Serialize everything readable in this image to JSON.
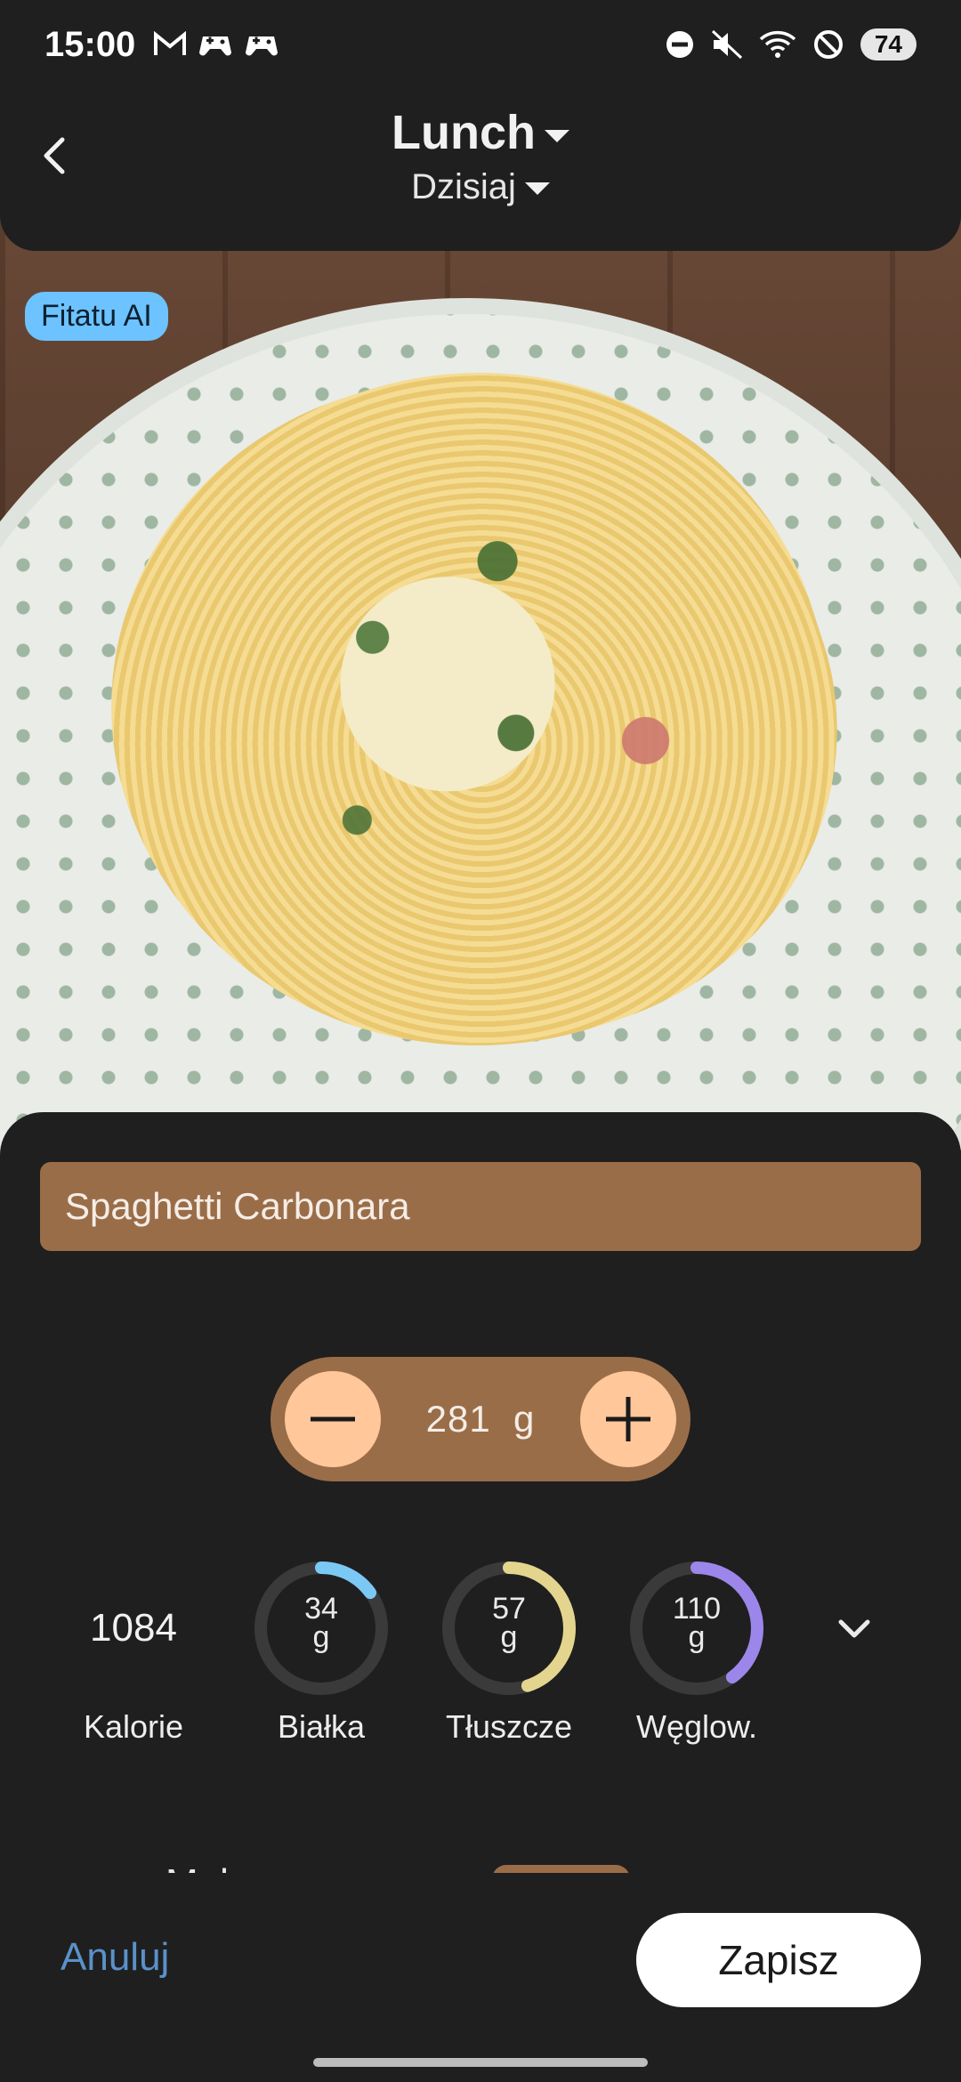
{
  "status_bar": {
    "time": "15:00",
    "battery": "74",
    "icons_left": [
      "gmail-icon",
      "game-icon",
      "game-icon"
    ],
    "icons_right": [
      "dnd-icon",
      "mute-icon",
      "wifi-icon",
      "no-sim-icon"
    ]
  },
  "header": {
    "meal": "Lunch",
    "day": "Dzisiaj"
  },
  "badge": "Fitatu AI",
  "product": {
    "name": "Spaghetti Carbonara"
  },
  "portion": {
    "value": "281",
    "unit": "g"
  },
  "macros": {
    "calories": {
      "value": "1084",
      "label": "Kalorie"
    },
    "protein": {
      "value": "34",
      "unit": "g",
      "label": "Białka",
      "fraction": 0.15,
      "color": "#7cc8f5"
    },
    "fat": {
      "value": "57",
      "unit": "g",
      "label": "Tłuszcze",
      "fraction": 0.45,
      "color": "#e3d58e"
    },
    "carbs": {
      "value": "110",
      "unit": "g",
      "label": "Węglow.",
      "fraction": 0.4,
      "color": "#9d86e9"
    }
  },
  "ingredient": {
    "name": "Makaron"
  },
  "footer": {
    "cancel": "Anuluj",
    "save": "Zapisz"
  },
  "colors": {
    "accent_brown": "#9a6d49",
    "button_peach": "#ffc79a",
    "badge_blue": "#6cc3ff",
    "link_blue": "#5a91c9"
  }
}
